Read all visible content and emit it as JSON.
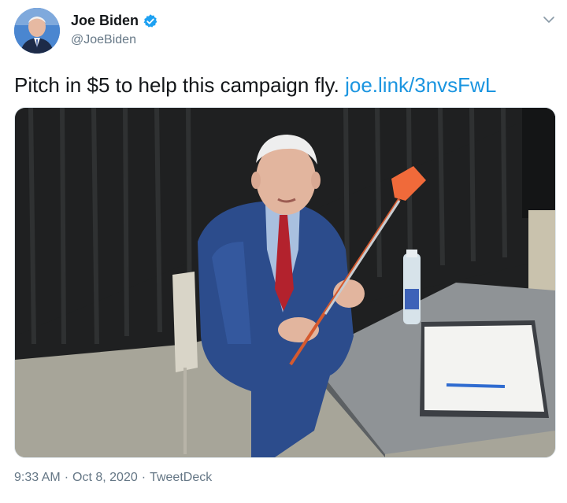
{
  "author": {
    "name": "Joe Biden",
    "handle": "@JoeBiden"
  },
  "tweet": {
    "text": "Pitch in $5 to help this campaign fly.",
    "link": "joe.link/3nvsFwL"
  },
  "meta": {
    "time": "9:33 AM",
    "separator": "·",
    "date": "Oct 8, 2020",
    "source": "TweetDeck"
  },
  "colors": {
    "link": "#1b95e0",
    "verified": "#1da1f2",
    "secondary_text": "#657786"
  },
  "icons": {
    "verified": "verified-badge-icon",
    "menu": "chevron-down-icon"
  }
}
